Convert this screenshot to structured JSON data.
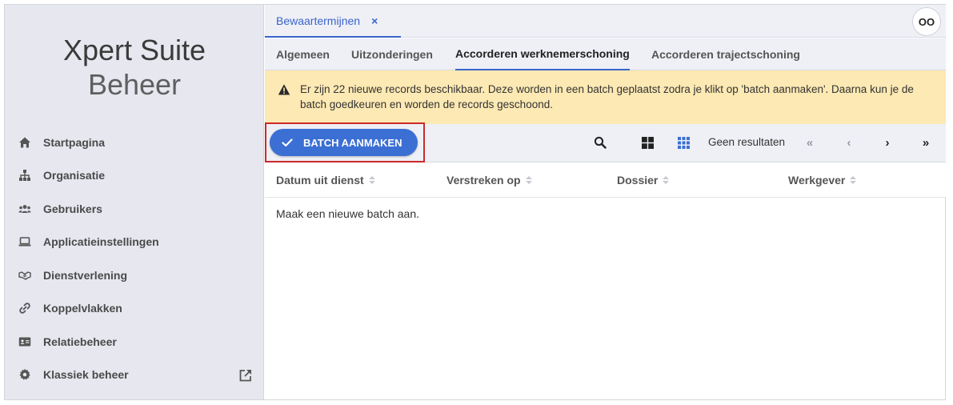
{
  "brand": {
    "line1": "Xpert Suite",
    "line2": "Beheer"
  },
  "sidebar": {
    "items": [
      {
        "label": "Startpagina",
        "icon": "home-icon"
      },
      {
        "label": "Organisatie",
        "icon": "org-chart-icon"
      },
      {
        "label": "Gebruikers",
        "icon": "users-icon"
      },
      {
        "label": "Applicatieinstellingen",
        "icon": "laptop-icon"
      },
      {
        "label": "Dienstverlening",
        "icon": "handshake-icon"
      },
      {
        "label": "Koppelvlakken",
        "icon": "link-icon"
      },
      {
        "label": "Relatiebeheer",
        "icon": "id-card-icon"
      },
      {
        "label": "Klassiek beheer",
        "icon": "gear-icon",
        "external": "external-link-icon"
      }
    ]
  },
  "header": {
    "doc_tab": "Bewaartermijnen",
    "close": "×",
    "avatar": "OO"
  },
  "tabs": [
    {
      "label": "Algemeen"
    },
    {
      "label": "Uitzonderingen"
    },
    {
      "label": "Accorderen werknemerschoning",
      "active": true
    },
    {
      "label": "Accorderen trajectschoning"
    }
  ],
  "alert": {
    "icon": "warning-icon",
    "message": "Er zijn 22 nieuwe records beschikbaar. Deze worden in een batch geplaatst zodra je klikt op 'batch aanmaken'. Daarna kun je de batch goedkeuren en worden de records geschoond."
  },
  "toolbar": {
    "batch_label": "BATCH AANMAKEN",
    "results": "Geen resultaten",
    "accent": "#3b6fd4",
    "pager": {
      "first": "«",
      "prev": "‹",
      "next": "›",
      "last": "»"
    }
  },
  "table": {
    "columns": [
      "Datum uit dienst",
      "Verstreken op",
      "Dossier",
      "Werkgever"
    ],
    "empty_text": "Maak een nieuwe batch aan."
  }
}
